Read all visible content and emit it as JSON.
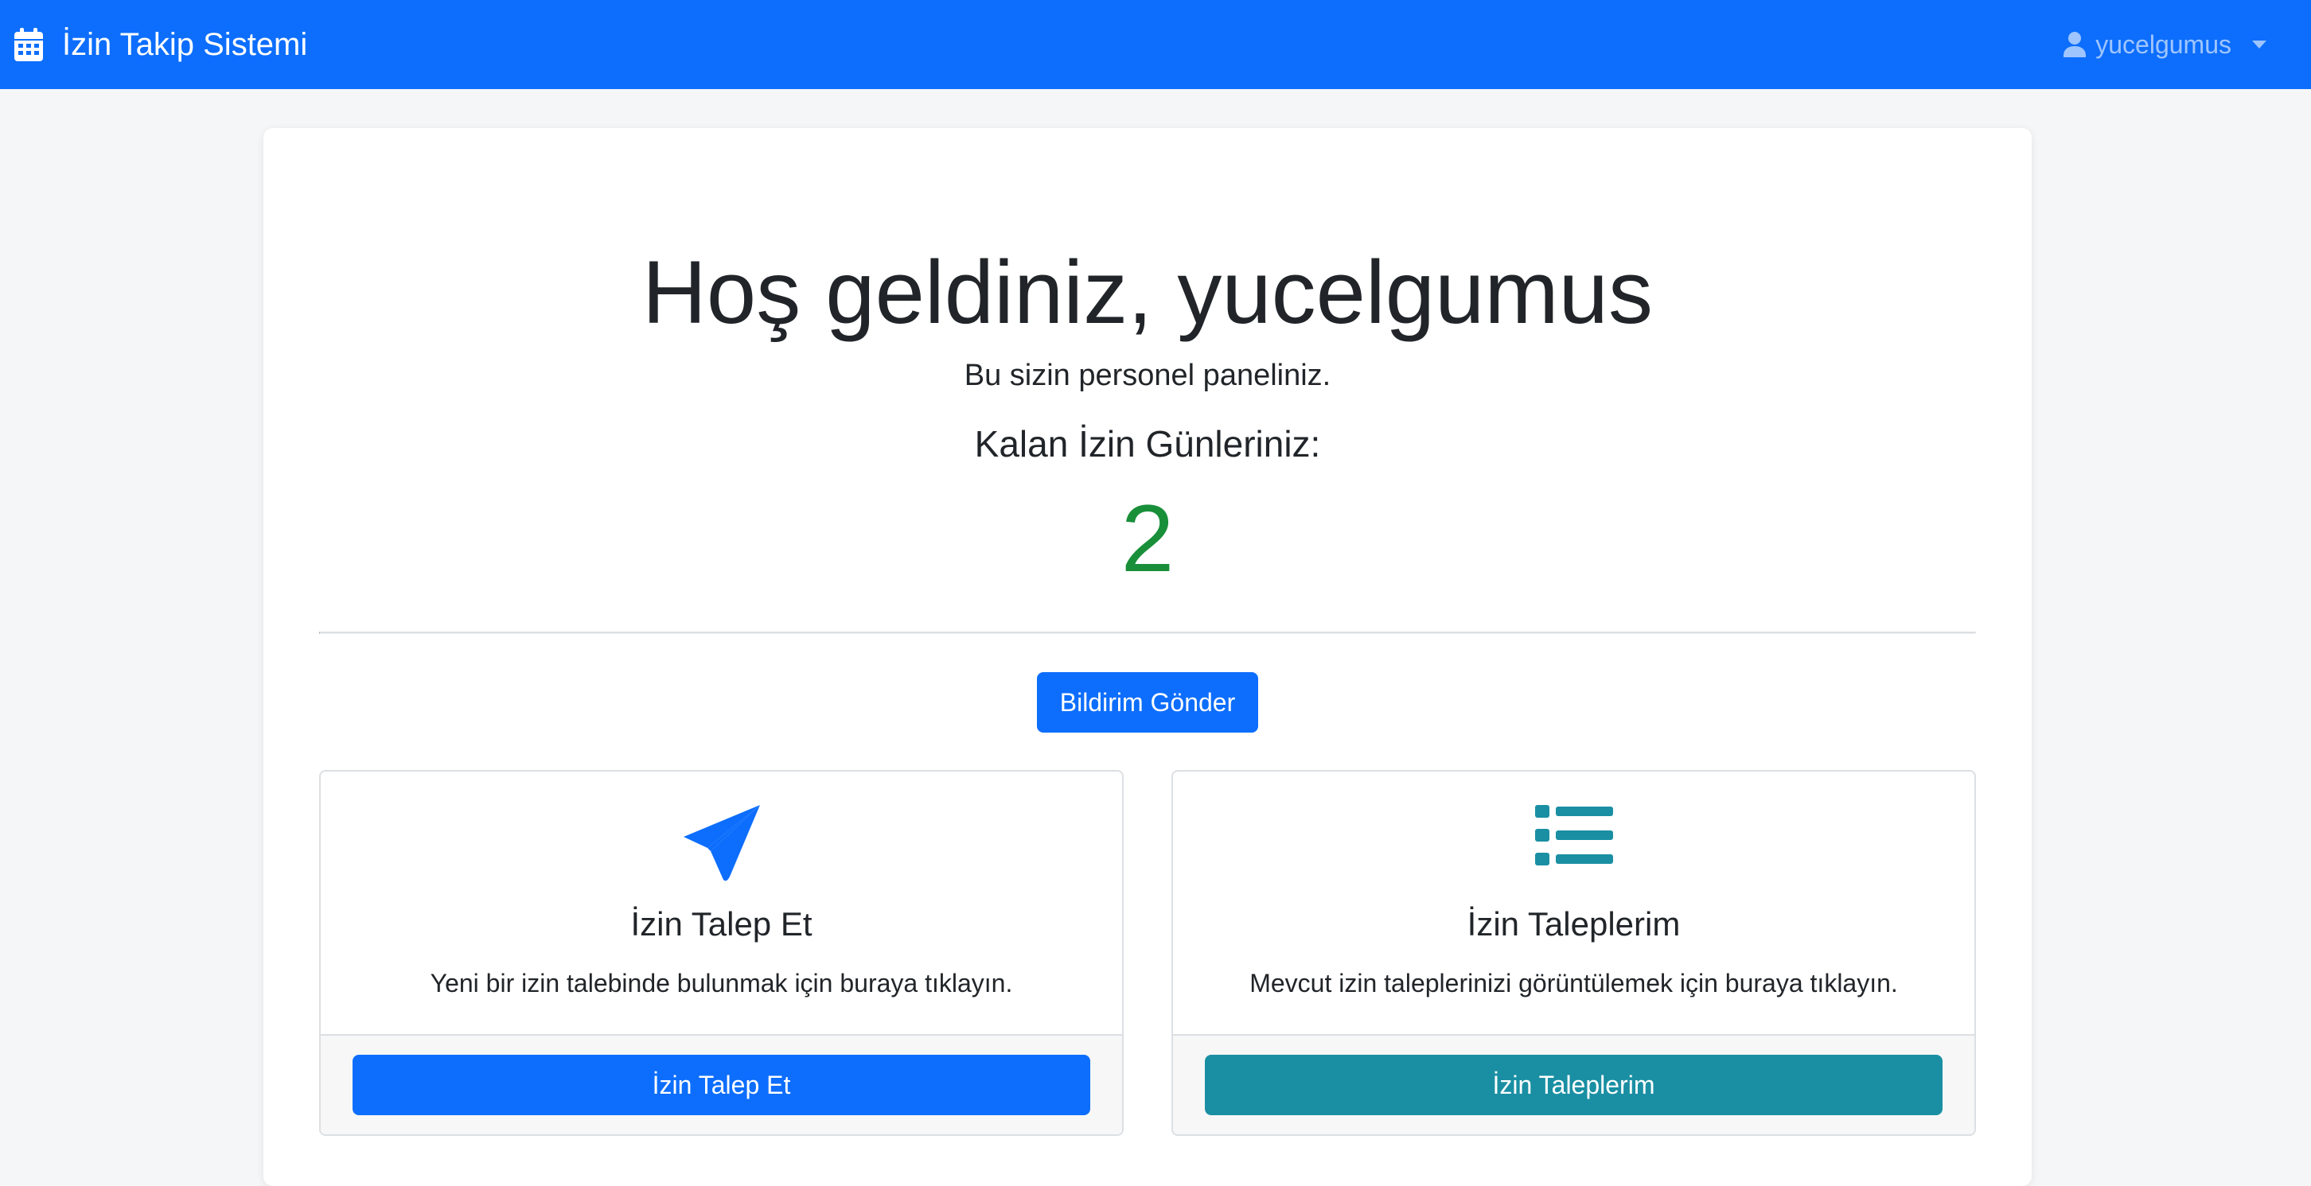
{
  "navbar": {
    "brand_icon": "calendar-icon",
    "brand_text": "İzin Takip Sistemi",
    "user_icon": "user-icon",
    "username": "yucelgumus",
    "brand_color": "#0d6efd"
  },
  "hero": {
    "welcome": "Hoş geldiniz, yucelgumus",
    "subtitle": "Bu sizin personel paneliniz.",
    "remaining_label": "Kalan İzin Günleriniz:",
    "remaining_value": "2",
    "remaining_color": "#198f3a"
  },
  "actions": {
    "notify_label": "Bildirim Gönder"
  },
  "cards": [
    {
      "icon": "paper-plane-icon",
      "icon_color": "#0d6efd",
      "title": "İzin Talep Et",
      "text": "Yeni bir izin talebinde bulunmak için buraya tıklayın.",
      "button": "İzin Talep Et"
    },
    {
      "icon": "list-icon",
      "icon_color": "#1a8fa3",
      "title": "İzin Taleplerim",
      "text": "Mevcut izin taleplerinizi görüntülemek için buraya tıklayın.",
      "button": "İzin Taleplerim"
    }
  ]
}
